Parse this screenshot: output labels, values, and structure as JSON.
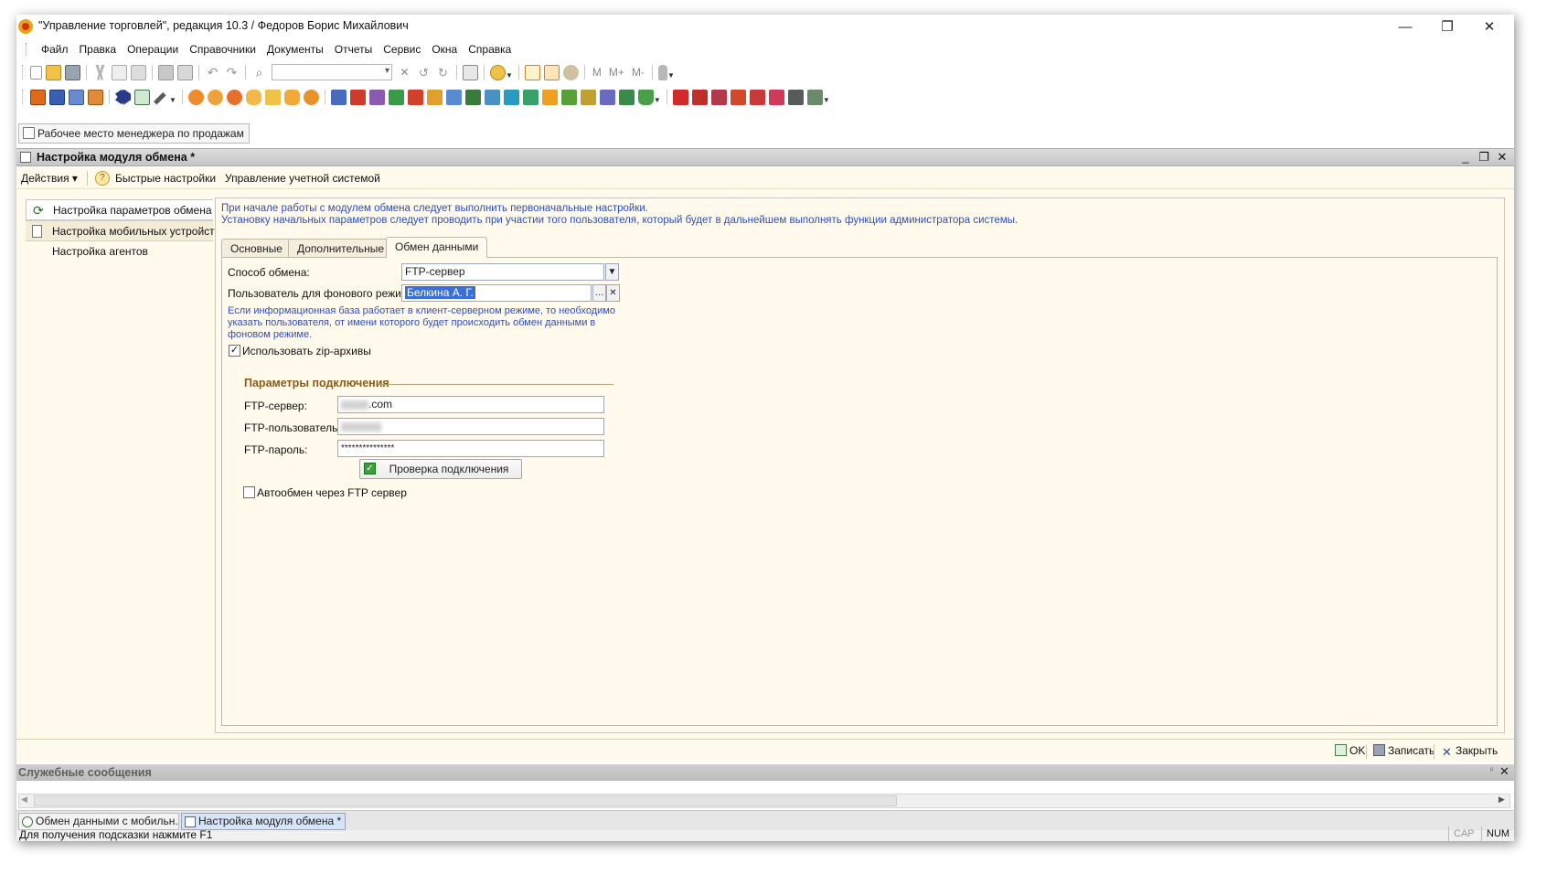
{
  "app": {
    "title": "\"Управление торговлей\", редакция 10.3 / Федоров Борис Михайлович",
    "minimize": "—",
    "restore": "❐",
    "close": "✕"
  },
  "menu": [
    "Файл",
    "Правка",
    "Операции",
    "Справочники",
    "Документы",
    "Отчеты",
    "Сервис",
    "Окна",
    "Справка"
  ],
  "toolbar": {
    "memory_buttons": [
      "M",
      "M+",
      "M-"
    ]
  },
  "quick_panel": {
    "label": "Рабочее место менеджера по продажам"
  },
  "document": {
    "title": "Настройка модуля обмена *",
    "actions": {
      "menu": "Действия ▾",
      "quick_settings": "Быстрые настройки",
      "account_management": "Управление учетной системой"
    },
    "nav": [
      {
        "label": "Настройка параметров обмена"
      },
      {
        "label": "Настройка мобильных устройств"
      },
      {
        "label": "Настройка агентов"
      }
    ],
    "info_lines": [
      "При начале работы с модулем обмена следует выполнить первоначальные настройки.",
      "Установку начальных параметров следует проводить при участии того пользователя, который будет в дальнейшем выполнять функции администратора системы."
    ],
    "tabs": [
      {
        "label": "Основные"
      },
      {
        "label": "Дополнительные"
      },
      {
        "label": "Обмен данными",
        "active": true
      }
    ],
    "exchange": {
      "method_label": "Способ обмена:",
      "method_value": "FTP-сервер",
      "user_label": "Пользователь для фонового режима:",
      "user_value": "Белкина А. Г.",
      "hint_lines": [
        "Если информационная база работает в клиент-серверном режиме, то необходимо",
        "указать пользователя, от имени которого будет происходить обмен данными в",
        "фоновом режиме."
      ],
      "zip_label": "Использовать zip-архивы",
      "zip_checked": true,
      "group_title": "Параметры подключения",
      "ftp_server_label": "FTP-сервер:",
      "ftp_server_value": ".com",
      "ftp_user_label": "FTP-пользователь:",
      "ftp_password_label": "FTP-пароль:",
      "ftp_password_value": "***************",
      "check_button": "Проверка подключения",
      "auto_label": "Автообмен через FTP сервер",
      "auto_checked": false
    },
    "commands": {
      "ok": "OK",
      "save": "Записать",
      "close": "Закрыть"
    }
  },
  "service_messages": {
    "title": "Служебные сообщения"
  },
  "taskbar": [
    {
      "label": "Обмен данными с мобильн..."
    },
    {
      "label": "Настройка модуля обмена *",
      "active": true
    }
  ],
  "status": {
    "hint": "Для получения подсказки нажмите F1",
    "cap": "CAP",
    "num": "NUM"
  },
  "colors": {
    "panel_bg": "#fffaec",
    "info_text": "#2f4fb8",
    "group_title": "#8a5a16",
    "selection": "#3a6fd8"
  }
}
